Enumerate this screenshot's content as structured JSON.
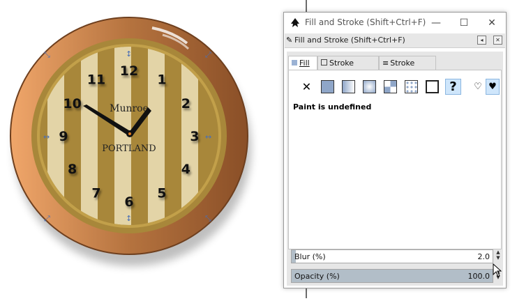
{
  "canvas": {
    "clock": {
      "brand_top": "Munroe",
      "brand_bottom": "PORTLAND",
      "numbers": [
        "12",
        "1",
        "2",
        "3",
        "4",
        "5",
        "6",
        "7",
        "8",
        "9",
        "10",
        "11"
      ],
      "colors": {
        "stripe_dark": "#a8873a",
        "stripe_light": "#e3d4a7",
        "frame": "#b5733f",
        "frame_highlight": "#e6a36e",
        "hand": "#111111",
        "center_dot": "#e07b22"
      }
    },
    "selection_handle_icons": [
      "scale-arrow-icon",
      "rotate-arrow-icon"
    ]
  },
  "window": {
    "title": "Fill and Stroke (Shift+Ctrl+F)",
    "minimize_icon": "minimize-icon",
    "maximize_icon": "maximize-icon",
    "close_icon": "close-icon"
  },
  "dock": {
    "title": "Fill and Stroke (Shift+Ctrl+F)"
  },
  "tabs": [
    {
      "label": "Fill",
      "icon": "fill-icon",
      "active": true
    },
    {
      "label": "Stroke paint",
      "icon": "stroke-paint-icon",
      "active": false
    },
    {
      "label": "Stroke style",
      "icon": "stroke-style-icon",
      "active": false
    }
  ],
  "paint_buttons": [
    {
      "name": "no-paint",
      "glyph": "✕"
    },
    {
      "name": "flat-color"
    },
    {
      "name": "linear-gradient"
    },
    {
      "name": "radial-gradient"
    },
    {
      "name": "mesh-gradient"
    },
    {
      "name": "pattern"
    },
    {
      "name": "swatch"
    },
    {
      "name": "unset",
      "glyph": "?"
    }
  ],
  "fill_rule_buttons": [
    "fill-rule-evenodd-icon",
    "fill-rule-nonzero-icon"
  ],
  "status_text": "Paint is undefined",
  "blur": {
    "label": "Blur (%)",
    "value": "2.0"
  },
  "opacity": {
    "label": "Opacity (%)",
    "value": "100.0"
  },
  "colors": {
    "accent_selected": "#cfe6fb",
    "slider_fill": "#b2bec8"
  }
}
